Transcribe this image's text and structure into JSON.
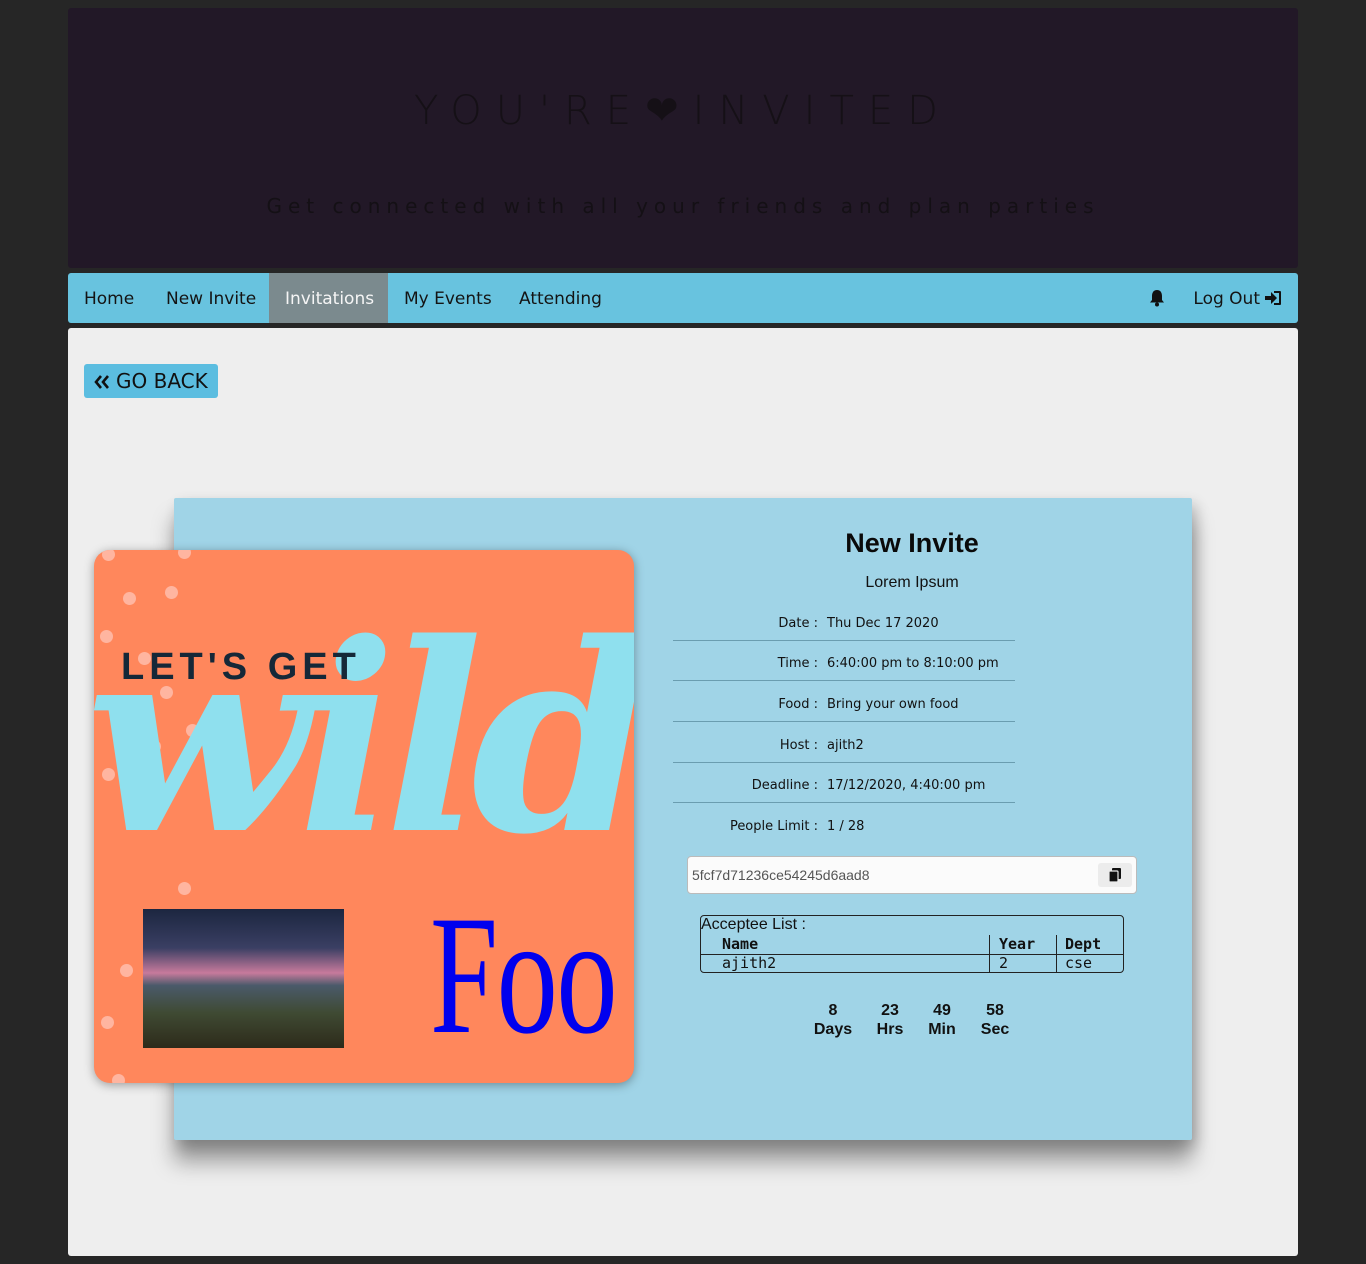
{
  "header": {
    "title": "YOU'RE❤INVITED",
    "subtitle": "Get connected with all your friends and plan parties"
  },
  "nav": {
    "items": [
      {
        "label": "Home"
      },
      {
        "label": "New Invite"
      },
      {
        "label": "Invitations",
        "active": true
      },
      {
        "label": "My Events"
      },
      {
        "label": "Attending"
      }
    ],
    "notification_icon": "bell-icon",
    "logout_label": "Log Out",
    "logout_icon": "sign-in-icon"
  },
  "back_button": {
    "label": "GO BACK",
    "icon": "double-chevron-left-icon"
  },
  "invite": {
    "poster": {
      "headline": "LET'S GET",
      "script_word": "wild",
      "caption": "Foo"
    },
    "title": "New Invite",
    "description": "Lorem Ipsum",
    "details": [
      {
        "label": "Date :",
        "value": "Thu Dec 17 2020"
      },
      {
        "label": "Time :",
        "value": "6:40:00 pm to 8:10:00 pm"
      },
      {
        "label": "Food :",
        "value": "Bring your own food"
      },
      {
        "label": "Host :",
        "value": "ajith2"
      },
      {
        "label": "Deadline :",
        "value": "17/12/2020, 4:40:00 pm"
      },
      {
        "label": "People Limit :",
        "value": "1 / 28"
      }
    ],
    "invite_code": "5fcf7d71236ce54245d6aad8",
    "copy_icon": "clipboard-icon",
    "acceptee": {
      "caption": "Acceptee List :",
      "columns": [
        "Name",
        "Year",
        "Dept"
      ],
      "rows": [
        [
          "ajith2",
          "2",
          "cse"
        ]
      ]
    },
    "countdown": [
      {
        "value": "8",
        "unit": "Days"
      },
      {
        "value": "23",
        "unit": "Hrs"
      },
      {
        "value": "49",
        "unit": "Min"
      },
      {
        "value": "58",
        "unit": "Sec"
      }
    ]
  },
  "colors": {
    "hero_bg": "#221827",
    "nav_bg": "#68c3df",
    "nav_active": "#7b8a8e",
    "panel_bg": "#a0d4e7",
    "poster_bg": "#ff875c",
    "poster_script": "#8fe0ee",
    "poster_caption": "#0000ee"
  }
}
